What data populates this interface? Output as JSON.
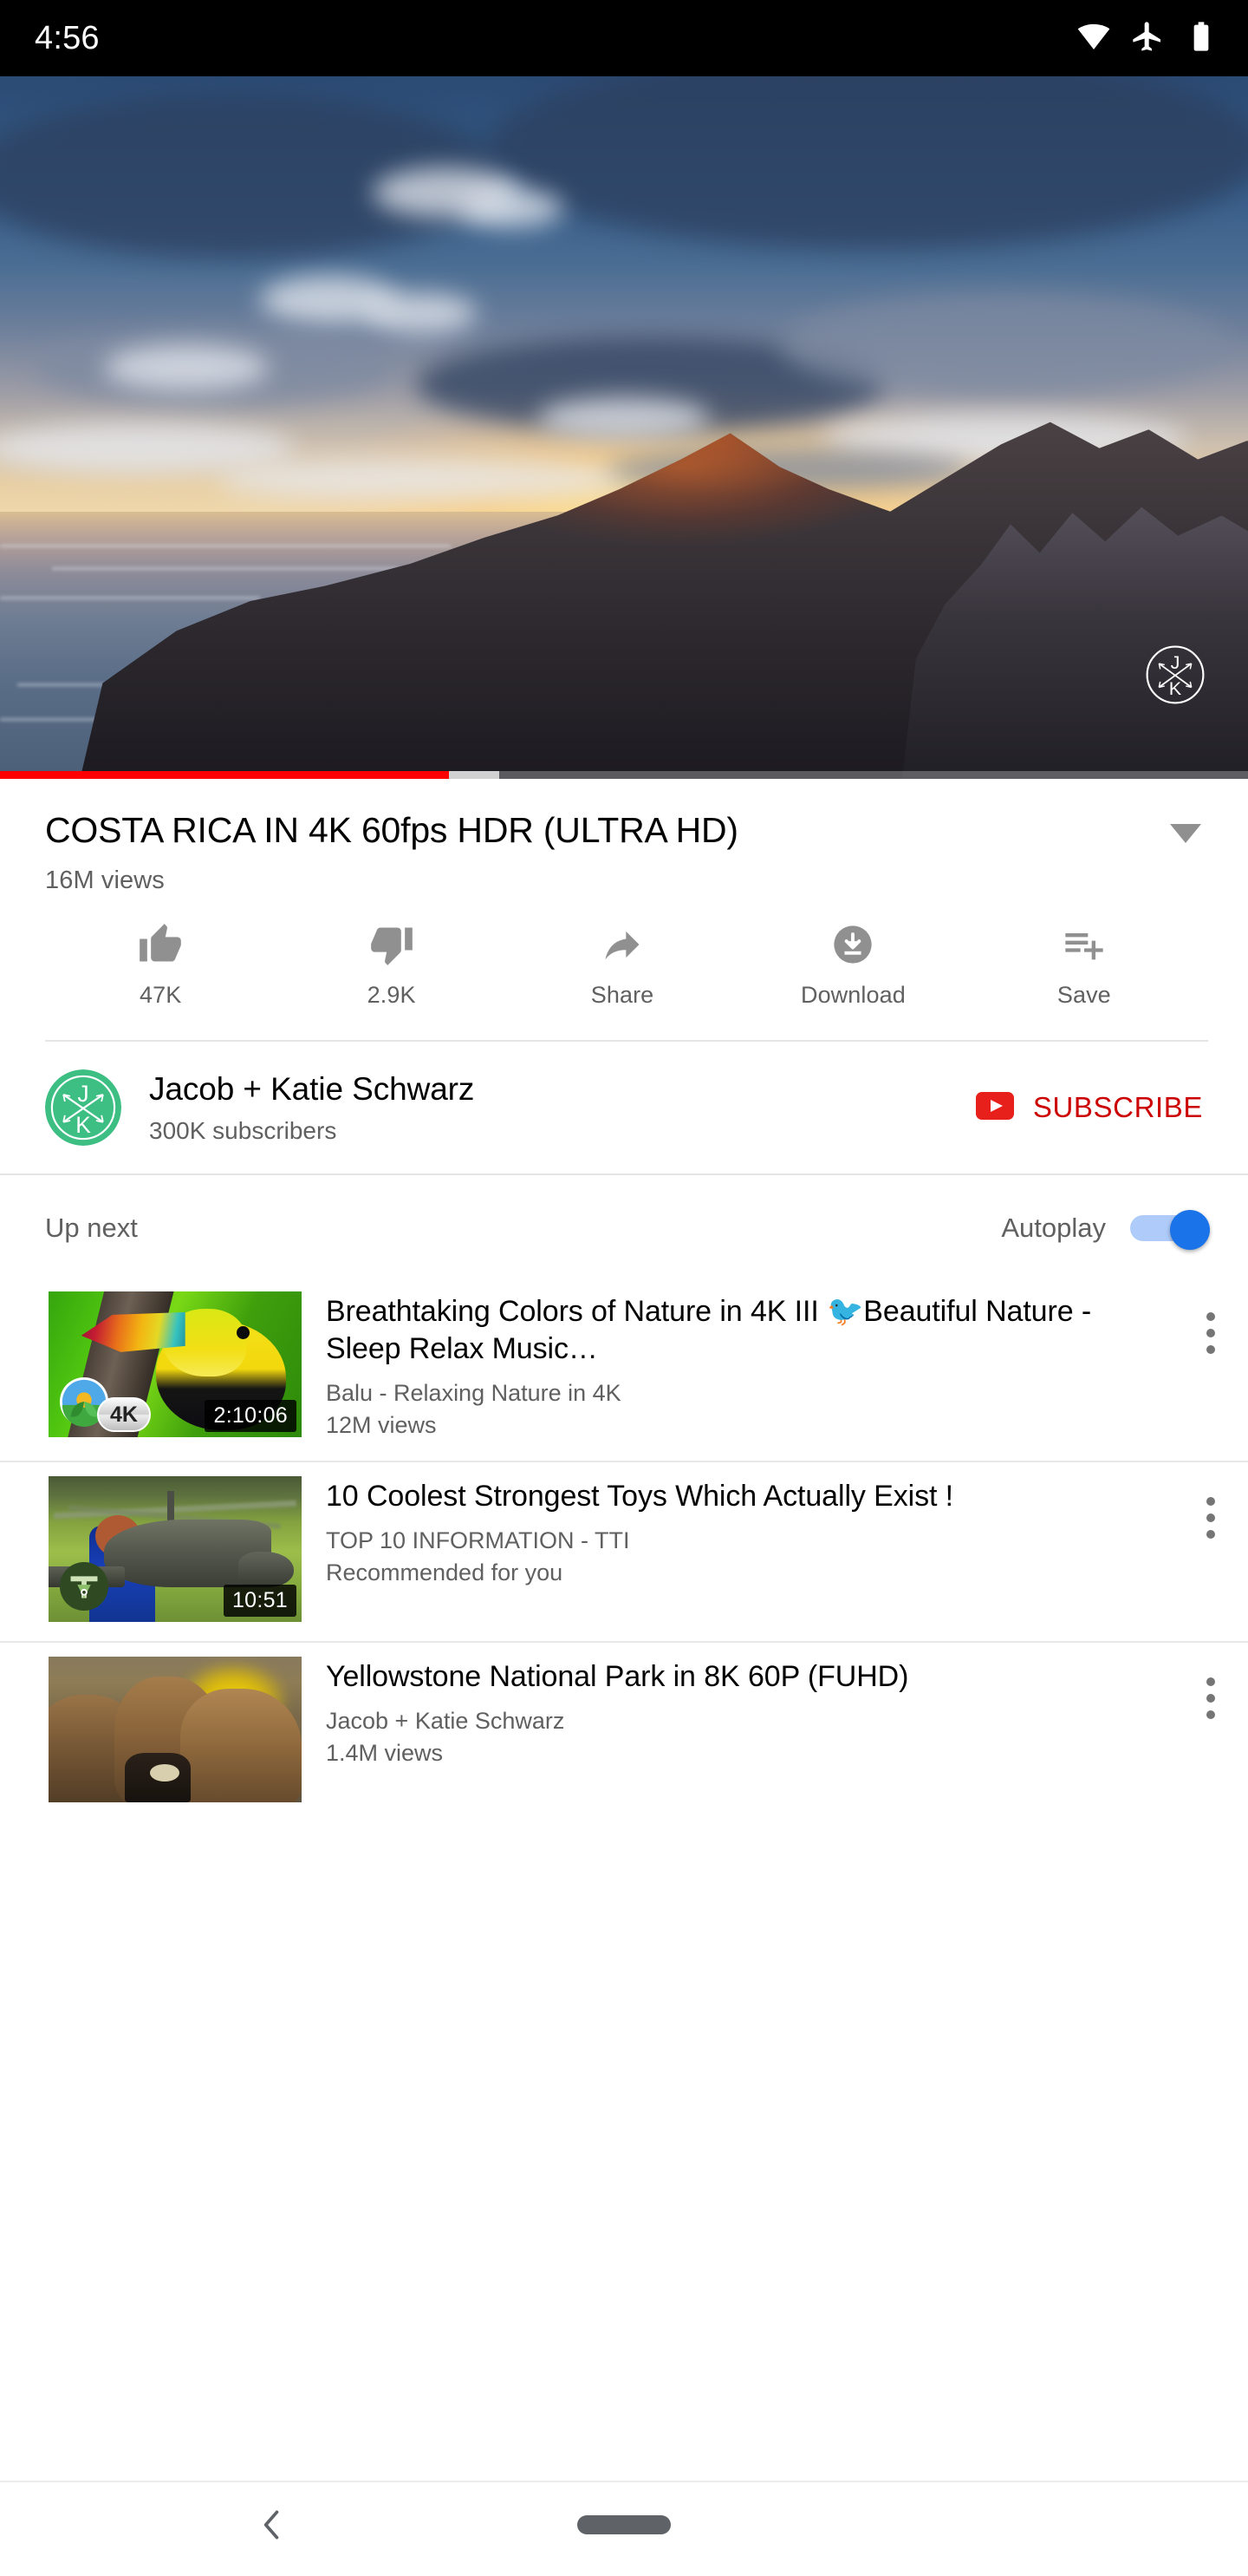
{
  "status_bar": {
    "time": "4:56",
    "icons": [
      "wifi-icon",
      "airplane-mode-icon",
      "battery-icon"
    ]
  },
  "player": {
    "watermark": "channel-watermark-jk",
    "progress_percent": 36,
    "buffered_percent": 40,
    "played_color": "#ff0000",
    "scene": "sunset-seascape-rocks"
  },
  "video": {
    "title": "COSTA RICA IN 4K 60fps HDR (ULTRA HD)",
    "views": "16M views",
    "expand_icon": "chevron-down-icon"
  },
  "actions": [
    {
      "icon": "thumbs-up-icon",
      "label": "47K"
    },
    {
      "icon": "thumbs-down-icon",
      "label": "2.9K"
    },
    {
      "icon": "share-icon",
      "label": "Share"
    },
    {
      "icon": "download-icon",
      "label": "Download"
    },
    {
      "icon": "playlist-add-icon",
      "label": "Save"
    }
  ],
  "channel": {
    "avatar": "jk-avatar",
    "avatar_color": "#3dbe83",
    "name": "Jacob + Katie Schwarz",
    "subscribers": "300K subscribers",
    "subscribe_label": "SUBSCRIBE",
    "subscribe_color": "#cc0000",
    "subscribe_icon": "youtube-play-icon"
  },
  "upnext": {
    "label": "Up next",
    "autoplay_label": "Autoplay",
    "autoplay_on": true,
    "toggle_color": "#1a73e8"
  },
  "suggestions": [
    {
      "title": "Breathtaking Colors of Nature in 4K III 🐦Beautiful Nature - Sleep Relax Music…",
      "channel": "Balu - Relaxing Nature in 4K",
      "meta": "12M views",
      "duration": "2:10:06",
      "badge": "4K",
      "thumb": "toucan-thumbnail",
      "menu_icon": "more-vert-icon"
    },
    {
      "title": "10 Coolest Strongest Toys Which Actually Exist !",
      "channel": "TOP 10 INFORMATION - TTI",
      "meta": "Recommended for you",
      "duration": "10:51",
      "badge": "",
      "thumb": "helicopter-thumbnail",
      "menu_icon": "more-vert-icon"
    },
    {
      "title": "Yellowstone National Park in 8K 60P (FUHD)",
      "channel": "Jacob + Katie Schwarz",
      "meta": "1.4M views",
      "duration": "",
      "badge": "",
      "thumb": "bison-thumbnail",
      "menu_icon": "more-vert-icon"
    }
  ],
  "navbar": {
    "back_icon": "back-chevron-icon",
    "home_icon": "home-gesture-pill"
  }
}
